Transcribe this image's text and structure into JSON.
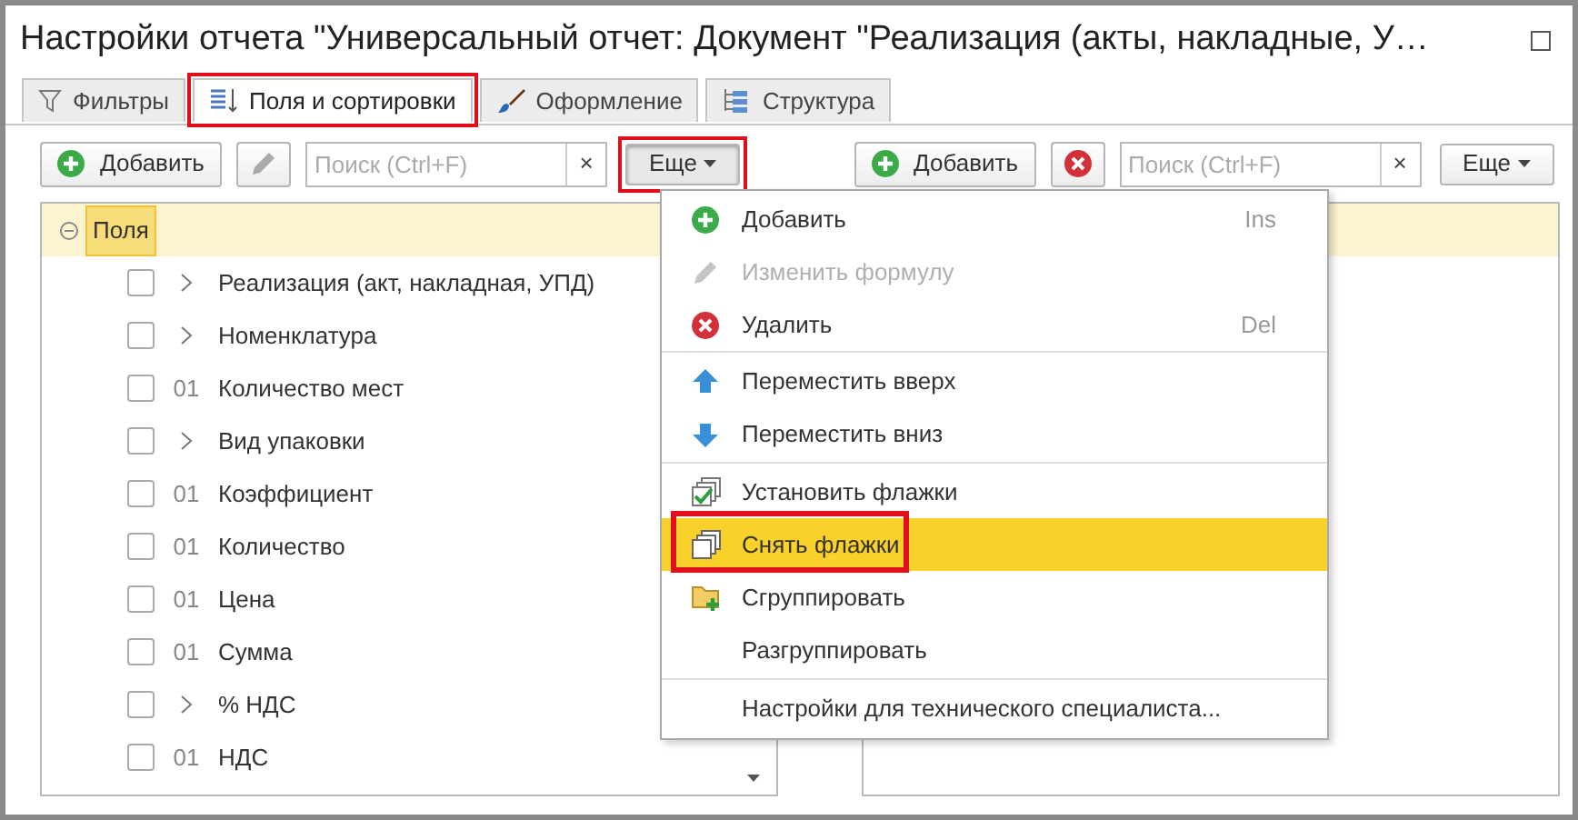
{
  "window": {
    "title": "Настройки отчета \"Универсальный отчет: Документ \"Реализация (акты, накладные, У…"
  },
  "tabs": [
    {
      "label": "Фильтры",
      "selected": false,
      "highlighted": false
    },
    {
      "label": "Поля и сортировки",
      "selected": true,
      "highlighted": true
    },
    {
      "label": "Оформление",
      "selected": false,
      "highlighted": false
    },
    {
      "label": "Структура",
      "selected": false,
      "highlighted": false
    }
  ],
  "left_toolbar": {
    "add_label": "Добавить",
    "search": {
      "placeholder": "Поиск (Ctrl+F)",
      "clear": "×"
    },
    "more": {
      "label": "Еще",
      "pressed": true,
      "highlighted": true
    }
  },
  "right_toolbar": {
    "add_label": "Добавить",
    "search": {
      "placeholder": "Поиск (Ctrl+F)",
      "clear": "×"
    },
    "more": {
      "label": "Еще",
      "pressed": false,
      "highlighted": false
    }
  },
  "tree": {
    "root": {
      "label": "Поля",
      "expanded": true,
      "selected": true
    },
    "children": [
      {
        "kind": "group",
        "label": "Реализация (акт, накладная, УПД)",
        "checked": false
      },
      {
        "kind": "group",
        "label": "Номенклатура",
        "checked": false
      },
      {
        "kind": "field",
        "prefix": "01",
        "label": "Количество мест",
        "checked": false
      },
      {
        "kind": "group",
        "label": "Вид упаковки",
        "checked": false
      },
      {
        "kind": "field",
        "prefix": "01",
        "label": "Коэффициент",
        "checked": false
      },
      {
        "kind": "field",
        "prefix": "01",
        "label": "Количество",
        "checked": false
      },
      {
        "kind": "field",
        "prefix": "01",
        "label": "Цена",
        "checked": false
      },
      {
        "kind": "field",
        "prefix": "01",
        "label": "Сумма",
        "checked": false
      },
      {
        "kind": "group",
        "label": "% НДС",
        "checked": false
      },
      {
        "kind": "field",
        "prefix": "01",
        "label": "НДС",
        "checked": false
      }
    ]
  },
  "menu": {
    "groups": [
      [
        {
          "label": "Добавить",
          "shortcut": "Ins",
          "disabled": false,
          "selected": false,
          "highlighted": false
        },
        {
          "label": "Изменить формулу",
          "disabled": true,
          "selected": false,
          "highlighted": false
        },
        {
          "label": "Удалить",
          "shortcut": "Del",
          "disabled": false,
          "selected": false,
          "highlighted": false
        }
      ],
      [
        {
          "label": "Переместить вверх",
          "disabled": false,
          "selected": false,
          "highlighted": false
        },
        {
          "label": "Переместить вниз",
          "disabled": false,
          "selected": false,
          "highlighted": false
        }
      ],
      [
        {
          "label": "Установить флажки",
          "disabled": false,
          "selected": false,
          "highlighted": false
        },
        {
          "label": "Снять флажки",
          "disabled": false,
          "selected": true,
          "highlighted": true
        },
        {
          "label": "Сгруппировать",
          "disabled": false,
          "selected": false,
          "highlighted": false
        },
        {
          "label": "Разгруппировать",
          "disabled": false,
          "selected": false,
          "highlighted": false
        }
      ],
      [
        {
          "label": "Настройки для технического специалиста...",
          "disabled": false,
          "selected": false,
          "highlighted": false
        }
      ]
    ]
  }
}
